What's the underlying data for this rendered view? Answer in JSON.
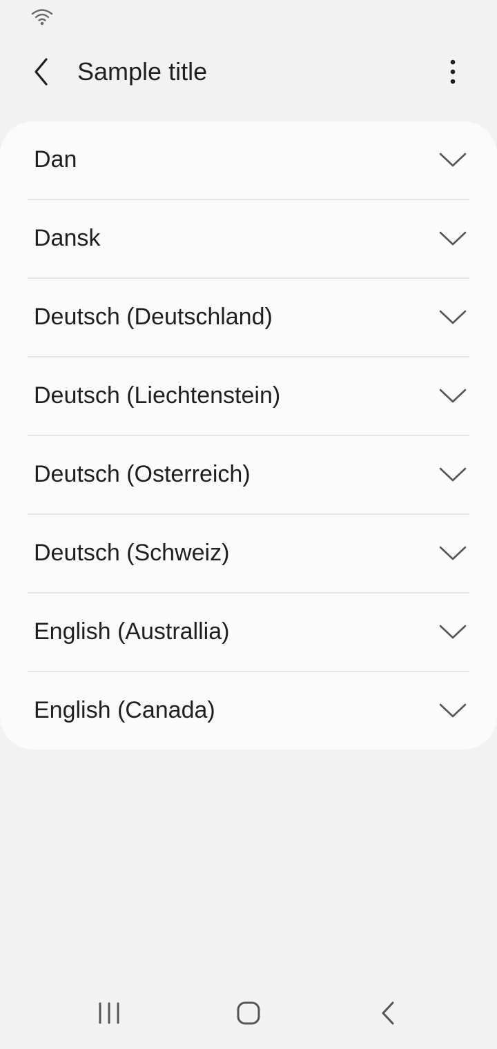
{
  "status_bar": {
    "icons": [
      "wifi-icon"
    ]
  },
  "app_bar": {
    "title": "Sample title",
    "back_icon": "chevron-left-icon",
    "more_icon": "more-vertical-icon"
  },
  "list": {
    "items": [
      {
        "label": "Dan",
        "icon": "chevron-down-icon"
      },
      {
        "label": "Dansk",
        "icon": "chevron-down-icon"
      },
      {
        "label": "Deutsch (Deutschland)",
        "icon": "chevron-down-icon"
      },
      {
        "label": "Deutsch (Liechtenstein)",
        "icon": "chevron-down-icon"
      },
      {
        "label": "Deutsch (Osterreich)",
        "icon": "chevron-down-icon"
      },
      {
        "label": "Deutsch (Schweiz)",
        "icon": "chevron-down-icon"
      },
      {
        "label": "English (Australlia)",
        "icon": "chevron-down-icon"
      },
      {
        "label": "English (Canada)",
        "icon": "chevron-down-icon"
      }
    ]
  },
  "nav_bar": {
    "buttons": [
      "recent-apps-icon",
      "home-icon",
      "back-icon"
    ]
  },
  "colors": {
    "background": "#f2f2f2",
    "card": "#fbfbfb",
    "text": "#1f1f1f",
    "icon": "#555555",
    "divider": "#e4e4e4"
  }
}
